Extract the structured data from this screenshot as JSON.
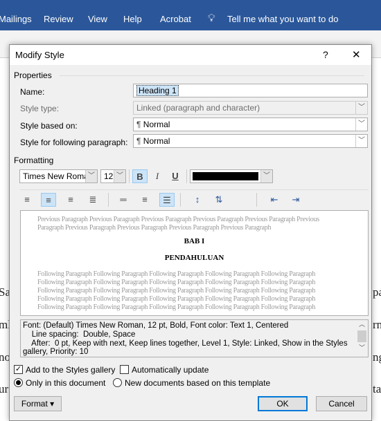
{
  "ribbon": {
    "tabs": [
      "Mailings",
      "Review",
      "View",
      "Help",
      "Acrobat"
    ],
    "tell_me": "Tell me what you want to do",
    "color": "#2b579a"
  },
  "document_fragments": {
    "left": [
      "Sa",
      "ml",
      "no",
      "ur"
    ],
    "right": [
      "pa",
      "rn",
      "ng",
      "ta"
    ]
  },
  "dialog": {
    "title": "Modify Style",
    "help": "?",
    "close": "✕",
    "properties": {
      "heading": "Properties",
      "name_label": "Name:",
      "name_value": "Heading 1",
      "style_type_label": "Style type:",
      "style_type_value": "Linked (paragraph and character)",
      "based_on_label": "Style based on:",
      "based_on_value": "Normal",
      "following_label": "Style for following paragraph:",
      "following_value": "Normal"
    },
    "formatting": {
      "heading": "Formatting",
      "font": "Times New Romar",
      "size": "12",
      "bold": "B",
      "italic": "I",
      "underline": "U",
      "font_color": "#000000",
      "bold_active": true,
      "alignment": "center",
      "spacing": "double"
    },
    "preview": {
      "previous": [
        "Previous Paragraph Previous Paragraph Previous Paragraph Previous Paragraph Previous Paragraph Previous",
        "Paragraph Previous Paragraph Previous Paragraph Previous Paragraph Previous Paragraph"
      ],
      "line1": "BAB I",
      "line2": "PENDAHULUAN",
      "following": [
        "Following Paragraph Following Paragraph Following Paragraph Following Paragraph Following Paragraph",
        "Following Paragraph Following Paragraph Following Paragraph Following Paragraph Following Paragraph",
        "Following Paragraph Following Paragraph Following Paragraph Following Paragraph Following Paragraph",
        "Following Paragraph Following Paragraph Following Paragraph Following Paragraph Following Paragraph",
        "Following Paragraph Following Paragraph Following Paragraph Following Paragraph Following Paragraph"
      ]
    },
    "description": [
      "Font: (Default) Times New Roman, 12 pt, Bold, Font color: Text 1, Centered",
      "    Line spacing:  Double, Space",
      "    After:  0 pt, Keep with next, Keep lines together, Level 1, Style: Linked, Show in the Styles",
      "gallery, Priority: 10"
    ],
    "add_gallery": {
      "label": "Add to the Styles gallery",
      "checked": true
    },
    "auto_update": {
      "label": "Automatically update",
      "checked": false
    },
    "only_doc": {
      "label": "Only in this document",
      "selected": true
    },
    "new_docs": {
      "label": "New documents based on this template",
      "selected": false
    },
    "format_button": "Format ▾",
    "ok": "OK",
    "cancel": "Cancel"
  }
}
